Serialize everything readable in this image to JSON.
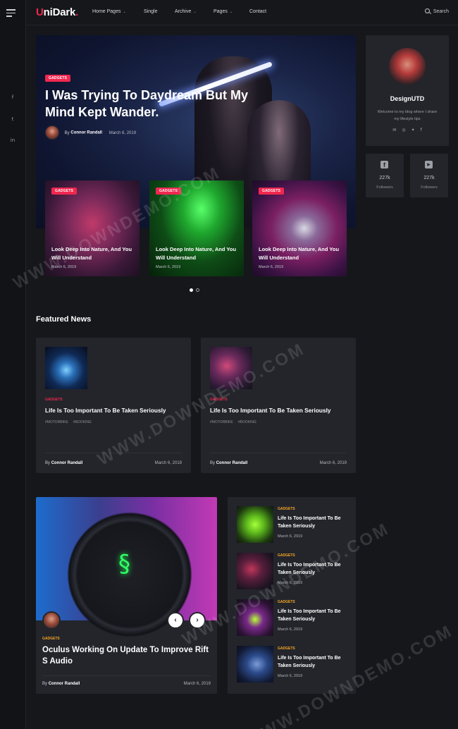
{
  "logo": {
    "brand_u": "U",
    "brand_rest": "niDark",
    "dot": "."
  },
  "nav": {
    "items": [
      {
        "label": "Home Pages",
        "dropdown": true
      },
      {
        "label": "Single",
        "dropdown": false
      },
      {
        "label": "Archive",
        "dropdown": true
      },
      {
        "label": "Pages",
        "dropdown": true
      },
      {
        "label": "Contact",
        "dropdown": false
      }
    ],
    "search_label": "Search"
  },
  "rail": {
    "social_icons": [
      "facebook-icon",
      "twitter-icon",
      "linkedin-icon"
    ],
    "social_glyphs": [
      "f",
      "t",
      "in"
    ]
  },
  "hero": {
    "badge": "GADGETS",
    "title": "I Was Trying To Daydream But My Mind Kept Wander.",
    "by": "By",
    "author": "Connor Randall",
    "date": "March 6, 2019"
  },
  "slider": {
    "cards": [
      {
        "badge": "GADGETS",
        "title": "Look Deep Into Nature, And You Will Understand",
        "date": "March 6, 2019"
      },
      {
        "badge": "GADGETS",
        "title": "Look Deep Into Nature, And You Will Understand",
        "date": "March 6, 2019"
      },
      {
        "badge": "GADGETS",
        "title": "Look Deep Into Nature, And You Will Understand",
        "date": "March 6, 2019"
      }
    ]
  },
  "profile": {
    "name": "DesignUTD",
    "bio": "Welcome to my blog where I share my lifestyle tips",
    "icons": [
      "email-icon",
      "dribbble-icon",
      "twitter-icon",
      "facebook-icon"
    ]
  },
  "followers": [
    {
      "icon": "facebook-icon",
      "glyph": "f",
      "count": "227k",
      "label": "Followers"
    },
    {
      "icon": "youtube-icon",
      "glyph": "▶",
      "count": "227k",
      "label": "Followers"
    }
  ],
  "featured": {
    "title": "Featured News",
    "cards": [
      {
        "category": "GADGETS",
        "title": "Life Is Too Important To Be Taken Seriously",
        "tags": [
          "#MOTORBIKE",
          "#BOOKING"
        ],
        "by": "By",
        "author": "Connor Randall",
        "date": "March 6, 2019"
      },
      {
        "category": "GADGETS",
        "title": "Life Is Too Important To Be Taken Seriously",
        "tags": [
          "#MOTORBIKE",
          "#BOOKING"
        ],
        "by": "By",
        "author": "Connor Randall",
        "date": "March 6, 2019"
      }
    ]
  },
  "big_post": {
    "category": "GADGETS",
    "title": "Oculus Working On Update To Improve Rift S Audio",
    "by": "By",
    "author": "Connor Randall",
    "date": "March 6, 2019",
    "prev": "‹",
    "next": "›"
  },
  "side_posts": [
    {
      "category": "GADGETS",
      "title": "Life Is Too Important To Be Taken Seriously",
      "date": "March 6, 2019"
    },
    {
      "category": "GADGETS",
      "title": "Life Is Too Important To Be Taken Seriously",
      "date": "March 6, 2019"
    },
    {
      "category": "GADGETS",
      "title": "Life Is Too Important To Be Taken Seriously",
      "date": "March 6, 2019"
    },
    {
      "category": "GADGETS",
      "title": "Life Is Too Important To Be Taken Seriously",
      "date": "March 6, 2019"
    }
  ],
  "colors": {
    "accent": "#f0274f",
    "category_gold": "#f5a623",
    "background": "#16171b",
    "card": "#23252b"
  },
  "watermark": "WWW.DOWNDEMO.COM"
}
